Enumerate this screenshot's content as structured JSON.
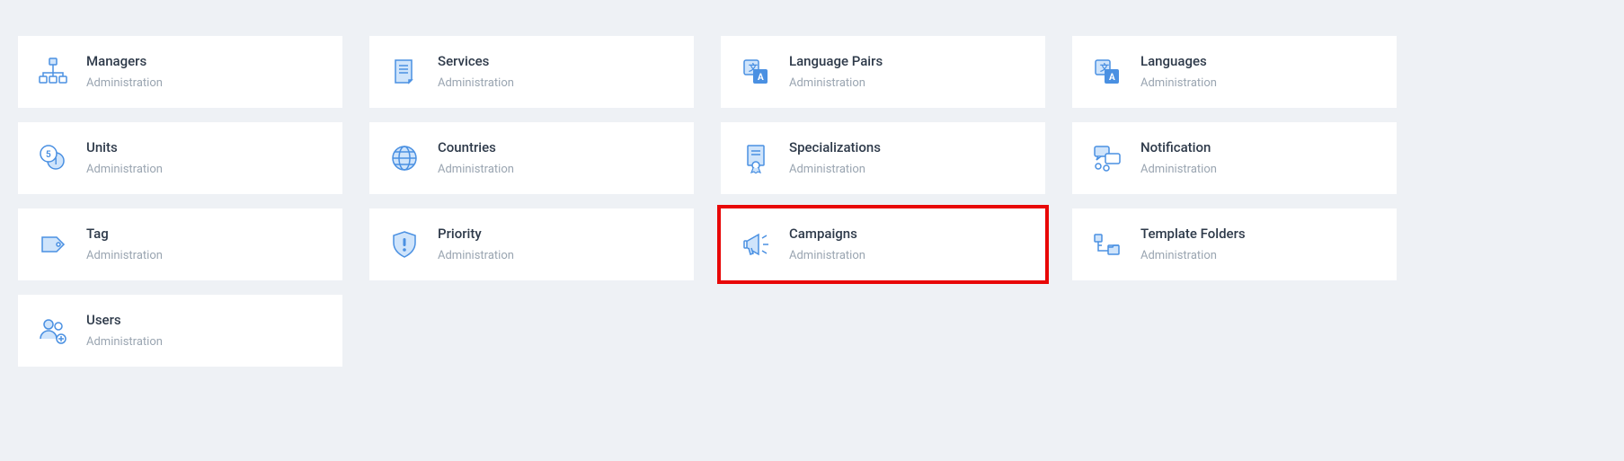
{
  "subtext": "Administration",
  "cards": [
    {
      "id": "managers",
      "title": "Managers",
      "icon": "hierarchy-icon"
    },
    {
      "id": "services",
      "title": "Services",
      "icon": "document-icon"
    },
    {
      "id": "language-pairs",
      "title": "Language Pairs",
      "icon": "translate-icon"
    },
    {
      "id": "languages",
      "title": "Languages",
      "icon": "translate-icon"
    },
    {
      "id": "units",
      "title": "Units",
      "icon": "coins-icon"
    },
    {
      "id": "countries",
      "title": "Countries",
      "icon": "globe-icon"
    },
    {
      "id": "specializations",
      "title": "Specializations",
      "icon": "certificate-icon"
    },
    {
      "id": "notification",
      "title": "Notification",
      "icon": "chat-icon"
    },
    {
      "id": "tag",
      "title": "Tag",
      "icon": "tag-icon"
    },
    {
      "id": "priority",
      "title": "Priority",
      "icon": "shield-icon"
    },
    {
      "id": "campaigns",
      "title": "Campaigns",
      "icon": "megaphone-icon",
      "highlight": true
    },
    {
      "id": "template-folders",
      "title": "Template Folders",
      "icon": "folders-icon"
    },
    {
      "id": "users",
      "title": "Users",
      "icon": "users-icon"
    }
  ],
  "colors": {
    "iconStroke": "#4a90e2",
    "iconFill": "#cfe4fb"
  }
}
